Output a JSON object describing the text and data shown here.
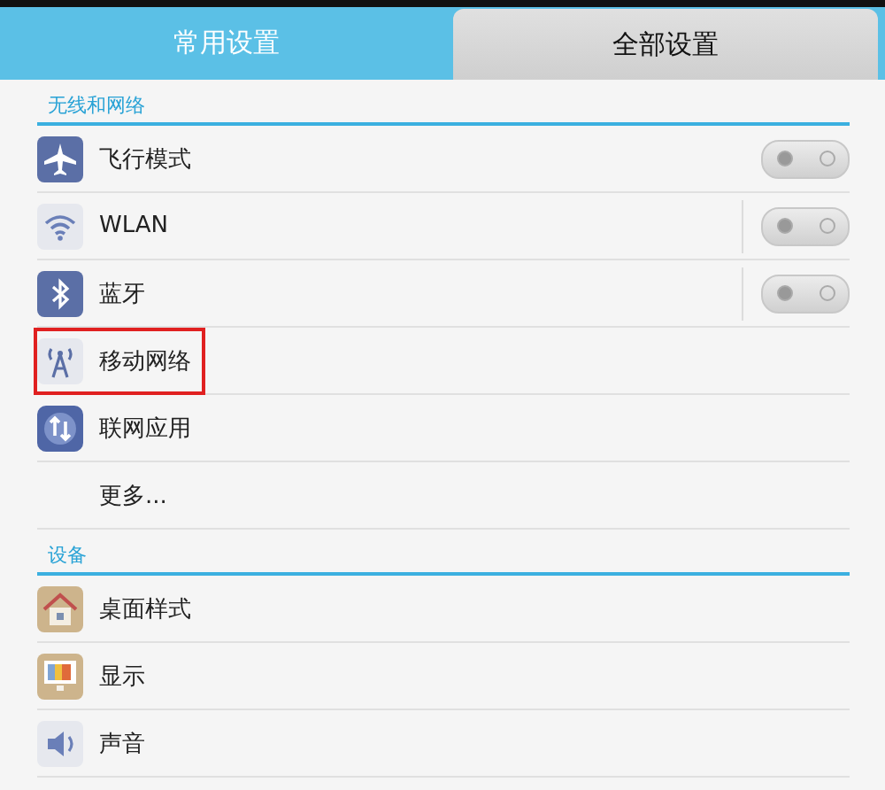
{
  "tabs": [
    {
      "label": "常用设置",
      "selected": false
    },
    {
      "label": "全部设置",
      "selected": true
    }
  ],
  "sections": [
    {
      "title": "无线和网络",
      "items": [
        {
          "label": "飞行模式",
          "kind": "toggle",
          "on": false,
          "highlighted": false
        },
        {
          "label": "WLAN",
          "kind": "toggle",
          "on": false,
          "highlighted": false
        },
        {
          "label": "蓝牙",
          "kind": "toggle",
          "on": false,
          "highlighted": false
        },
        {
          "label": "移动网络",
          "kind": "link",
          "highlighted": true
        },
        {
          "label": "联网应用",
          "kind": "link",
          "highlighted": false
        },
        {
          "label": "更多...",
          "kind": "link",
          "highlighted": false
        }
      ]
    },
    {
      "title": "设备",
      "items": [
        {
          "label": "桌面样式",
          "kind": "link",
          "highlighted": false
        },
        {
          "label": "显示",
          "kind": "link",
          "highlighted": false
        },
        {
          "label": "声音",
          "kind": "link",
          "highlighted": false
        }
      ]
    }
  ]
}
